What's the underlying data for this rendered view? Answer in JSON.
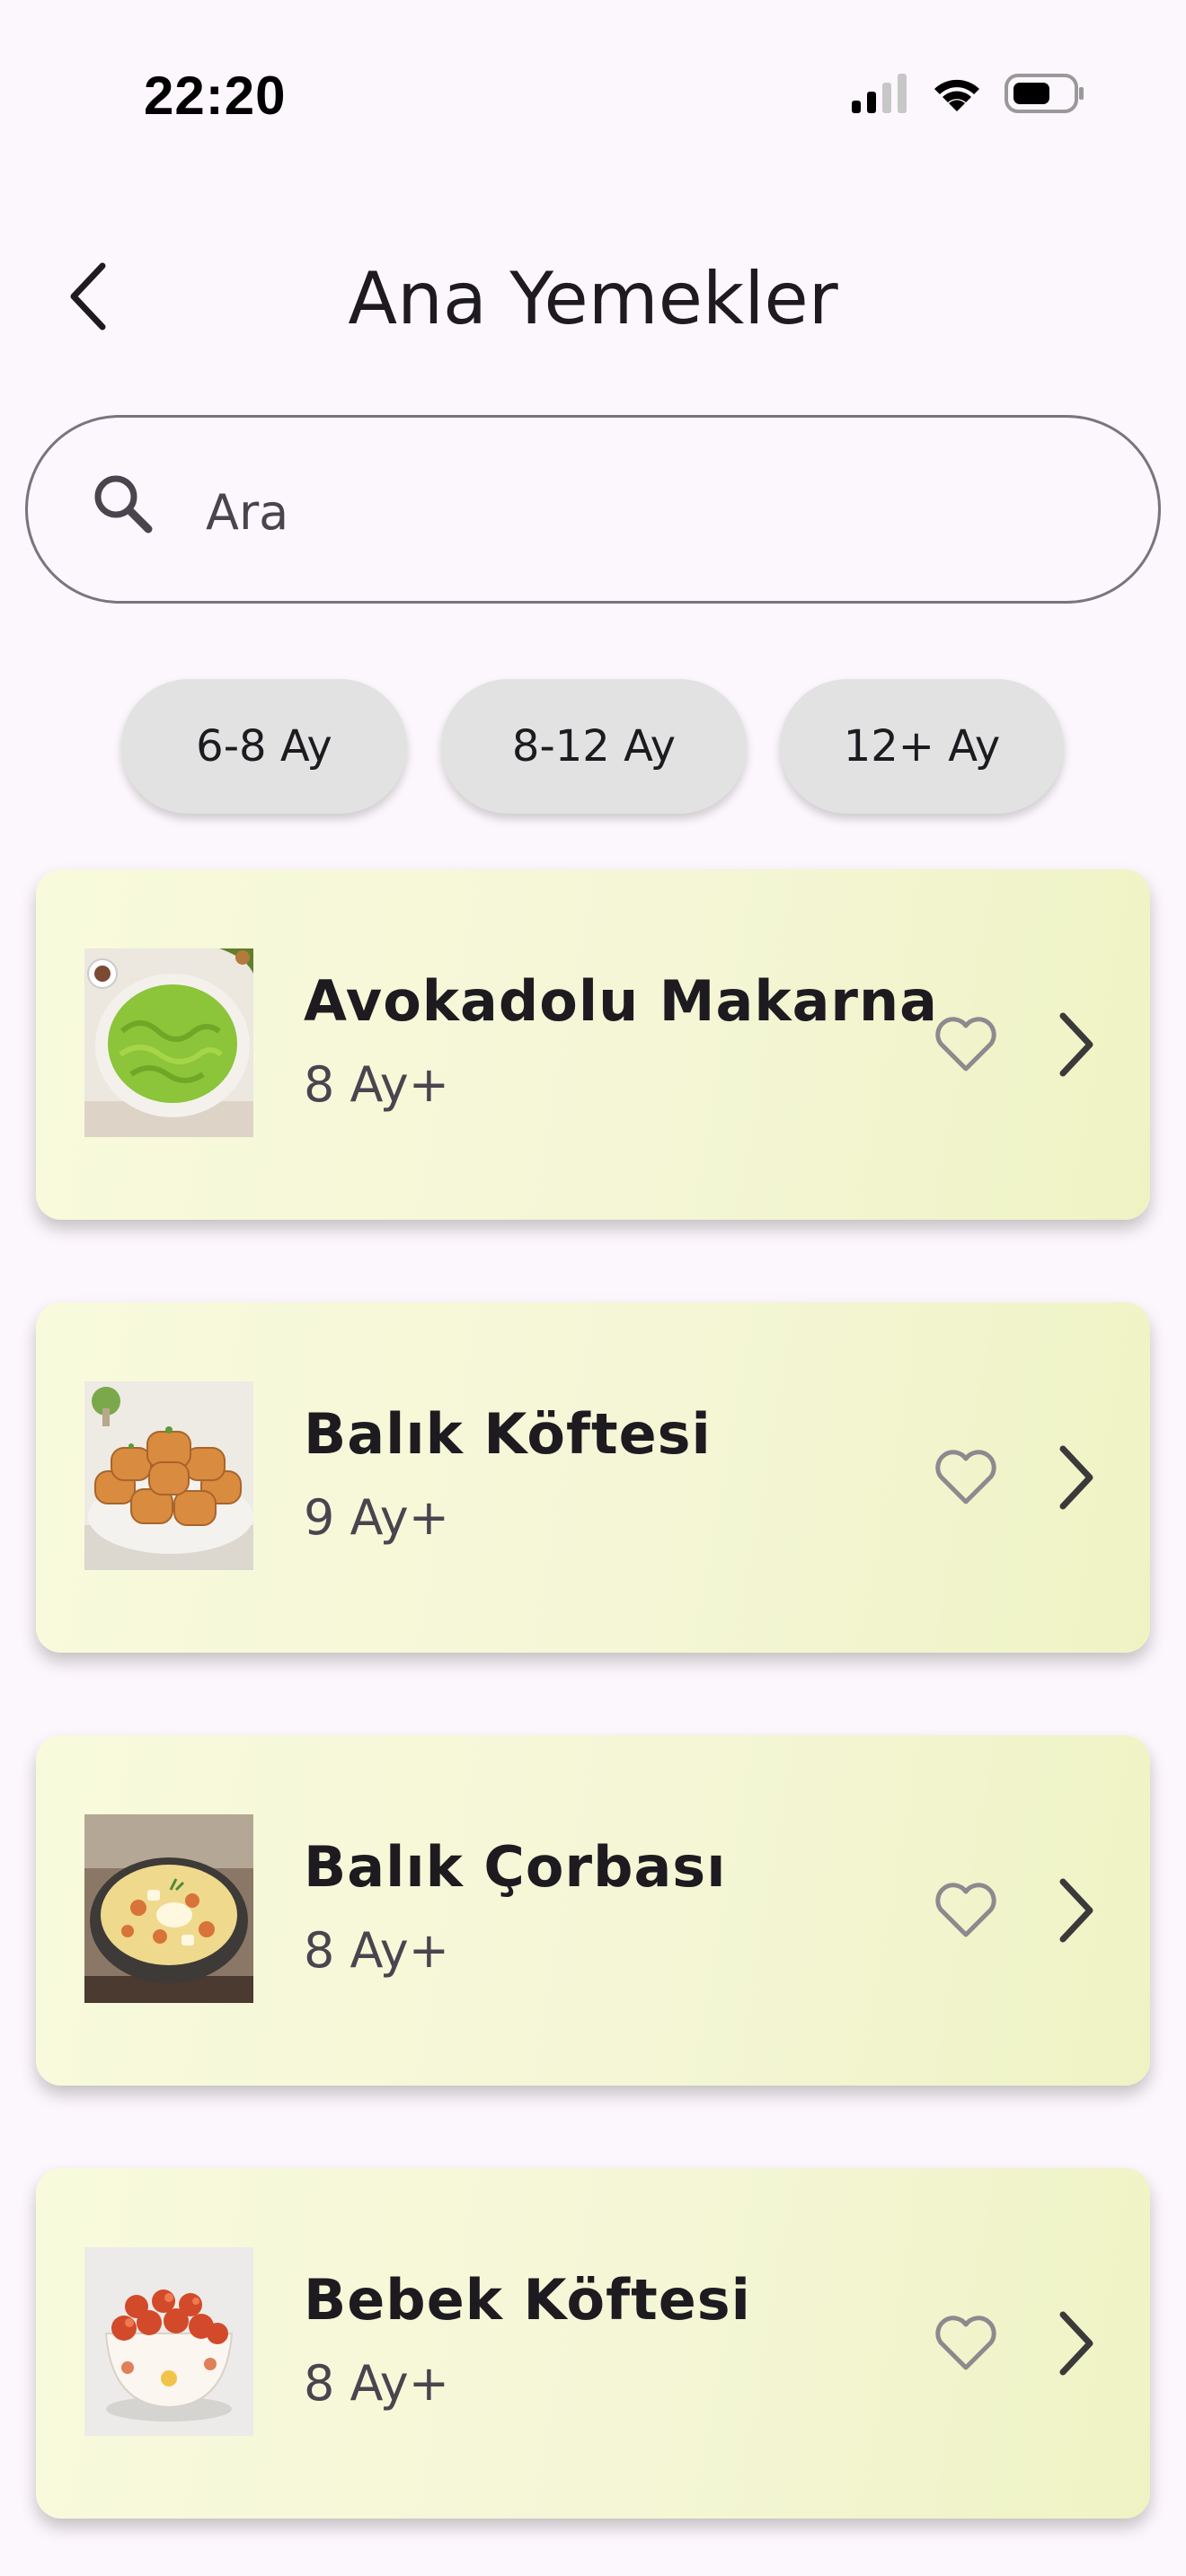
{
  "status_bar": {
    "time": "22:20"
  },
  "header": {
    "title": "Ana Yemekler"
  },
  "search": {
    "placeholder": "Ara",
    "value": ""
  },
  "filters": [
    {
      "label": "6-8 Ay"
    },
    {
      "label": "8-12 Ay"
    },
    {
      "label": "12+ Ay"
    }
  ],
  "recipes": [
    {
      "title": "Avokadolu Makarna",
      "age": "8 Ay+",
      "favorite": false
    },
    {
      "title": "Balık Köftesi",
      "age": "9 Ay+",
      "favorite": false
    },
    {
      "title": "Balık Çorbası",
      "age": "8 Ay+",
      "favorite": false
    },
    {
      "title": "Bebek Köftesi",
      "age": "8 Ay+",
      "favorite": false
    }
  ],
  "icons": {
    "back": "chevron-left-icon",
    "search": "search-icon",
    "favorite": "heart-outline-icon",
    "open": "chevron-right-icon"
  },
  "colors": {
    "background": "#fcf7fc",
    "card_start": "#f8fadc",
    "card_end": "#eff3c4",
    "chip": "#e2e2e2"
  }
}
